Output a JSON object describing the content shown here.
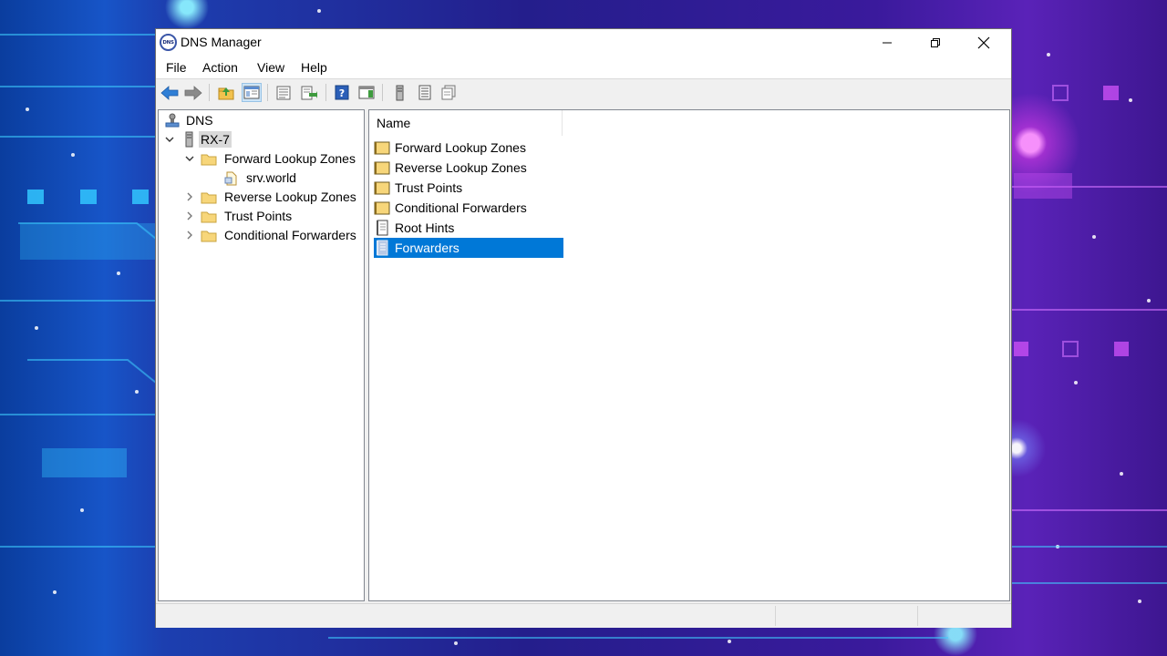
{
  "window": {
    "title": "DNS Manager",
    "app_icon_text": "DNS",
    "buttons": [
      "minimize",
      "restore",
      "close"
    ]
  },
  "menu": [
    {
      "label": "File"
    },
    {
      "label": "Action"
    },
    {
      "label": "View"
    },
    {
      "label": "Help"
    }
  ],
  "toolbar": {
    "icons": [
      "back-icon",
      "forward-icon",
      "up-level-icon",
      "show-hide-console-tree-icon",
      "properties-icon",
      "export-list-icon",
      "help-icon",
      "action-pane-icon",
      "server-icon",
      "list-view-icon",
      "copy-icon"
    ],
    "active": "show-hide-console-tree-icon"
  },
  "tree": {
    "root": "DNS",
    "server": "RX-7",
    "nodes": [
      {
        "label": "Forward Lookup Zones",
        "expanded": true,
        "children": [
          {
            "label": "srv.world"
          }
        ]
      },
      {
        "label": "Reverse Lookup Zones",
        "expanded": false
      },
      {
        "label": "Trust Points",
        "expanded": false
      },
      {
        "label": "Conditional Forwarders",
        "expanded": false
      }
    ],
    "selected": "RX-7"
  },
  "list": {
    "column_header": "Name",
    "items": [
      {
        "label": "Forward Lookup Zones",
        "icon": "folder-icon"
      },
      {
        "label": "Reverse Lookup Zones",
        "icon": "folder-icon"
      },
      {
        "label": "Trust Points",
        "icon": "folder-icon"
      },
      {
        "label": "Conditional Forwarders",
        "icon": "folder-icon"
      },
      {
        "label": "Root Hints",
        "icon": "document-icon"
      },
      {
        "label": "Forwarders",
        "icon": "forwarders-icon",
        "selected": true
      }
    ]
  },
  "colors": {
    "selection": "#0078d7",
    "tree_selection": "#d9d9d9",
    "folder": "#f7d67a"
  }
}
